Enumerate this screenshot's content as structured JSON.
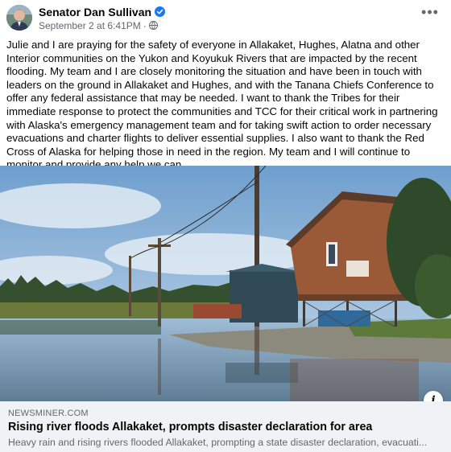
{
  "post": {
    "author": "Senator Dan Sullivan",
    "timestamp": "September 2 at 6:41PM",
    "separator": "·",
    "more_label": "•••",
    "body": "Julie and I are praying for the safety of everyone in Allakaket, Hughes, Alatna and other Interior communities on the Yukon and Koyukuk Rivers that are impacted by the recent flooding. My team and I are closely monitoring the situation and have been in touch with leaders on the ground in Allakaket and Hughes, and with the Tanana Chiefs Conference to offer any federal assistance that may be needed. I want to thank the Tribes for their immediate response to protect the communities and TCC for their critical work in partnering with Alaska's emergency management team and for taking swift action to order necessary evacuations and charter flights to deliver essential supplies. I also want to thank the Red Cross of Alaska for helping those in need in the region. My team and I will continue to monitor and provide any help we can."
  },
  "link": {
    "domain": "NEWSMINER.COM",
    "title": "Rising river floods Allakaket, prompts disaster declaration for area",
    "description": "Heavy rain and rising rivers flooded Allakaket, prompting a state disaster declaration, evacuati...",
    "info_label": "i"
  },
  "icons": {
    "verified": "verified-badge-icon",
    "audience": "globe-icon",
    "more": "more-options-icon",
    "info": "info-icon"
  },
  "colors": {
    "verified": "#1877f2",
    "secondary_text": "#65676b",
    "link_box_bg": "#f0f2f5"
  }
}
